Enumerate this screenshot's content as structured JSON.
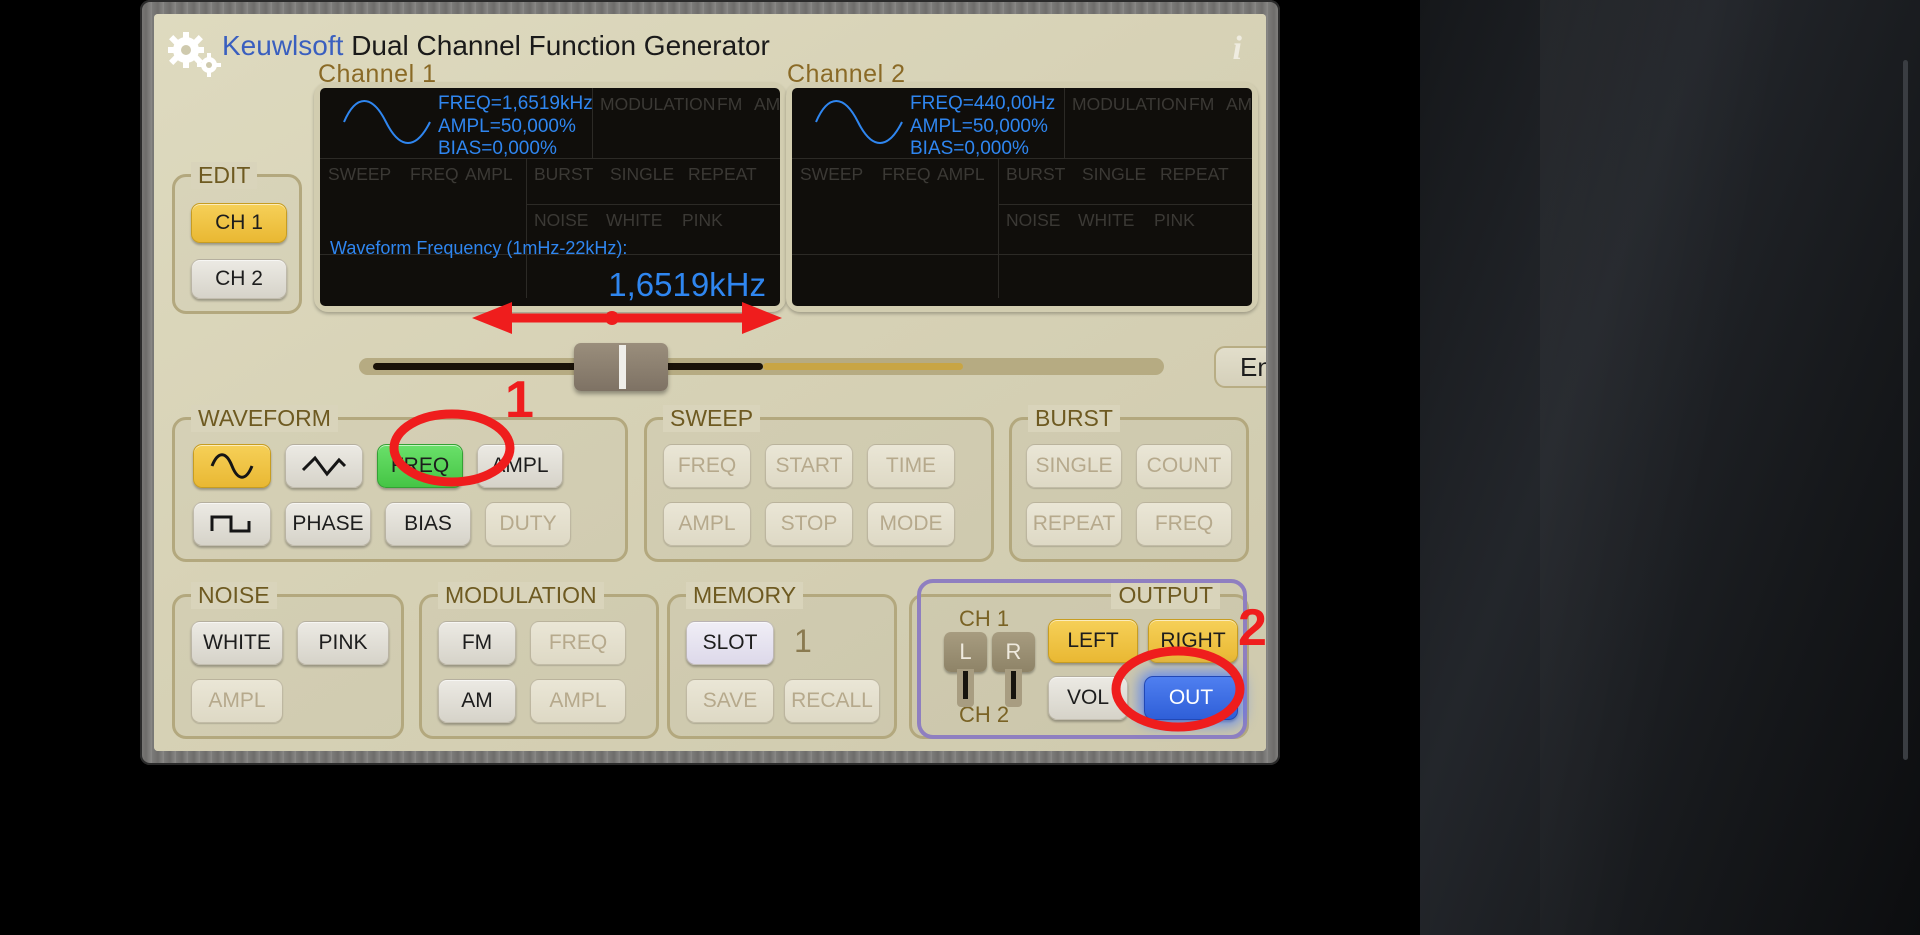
{
  "app": {
    "brand": "Keuwlsoft",
    "title": "Dual Channel Function Generator",
    "info_icon": "i",
    "gear_icon": "gears-icon"
  },
  "channels": {
    "ch1_label": "Channel 1",
    "ch2_label": "Channel 2"
  },
  "display_ch1": {
    "freq": "FREQ=1,6519kHz",
    "ampl": "AMPL=50,000%",
    "bias": "BIAS=0,000%",
    "modulation": "MODULATION",
    "fm": "FM",
    "am": "AM",
    "sweep": "SWEEP",
    "sweep_freq": "FREQ",
    "sweep_ampl": "AMPL",
    "burst": "BURST",
    "single": "SINGLE",
    "repeat": "REPEAT",
    "noise": "NOISE",
    "white": "WHITE",
    "pink": "PINK",
    "prompt": "Waveform Frequency (1mHz-22kHz):",
    "value": "1,6519kHz"
  },
  "display_ch2": {
    "freq": "FREQ=440,00Hz",
    "ampl": "AMPL=50,000%",
    "bias": "BIAS=0,000%",
    "modulation": "MODULATION",
    "fm": "FM",
    "am": "AM",
    "sweep": "SWEEP",
    "sweep_freq": "FREQ",
    "sweep_ampl": "AMPL",
    "burst": "BURST",
    "single": "SINGLE",
    "repeat": "REPEAT",
    "noise": "NOISE",
    "white": "WHITE",
    "pink": "PINK"
  },
  "edit": {
    "title": "EDIT",
    "ch1": "CH 1",
    "ch2": "CH 2"
  },
  "slider": {
    "enter_value": "Enter Value"
  },
  "waveform": {
    "title": "WAVEFORM",
    "sine_icon": "sine-wave-icon",
    "triangle_icon": "triangle-wave-icon",
    "square_icon": "square-wave-icon",
    "freq": "FREQ",
    "ampl": "AMPL",
    "phase": "PHASE",
    "bias": "BIAS",
    "duty": "DUTY"
  },
  "sweep": {
    "title": "SWEEP",
    "freq": "FREQ",
    "start": "START",
    "time": "TIME",
    "ampl": "AMPL",
    "stop": "STOP",
    "mode": "MODE"
  },
  "burst": {
    "title": "BURST",
    "single": "SINGLE",
    "count": "COUNT",
    "repeat": "REPEAT",
    "freq": "FREQ"
  },
  "noise": {
    "title": "NOISE",
    "white": "WHITE",
    "pink": "PINK",
    "ampl": "AMPL"
  },
  "modulation": {
    "title": "MODULATION",
    "fm": "FM",
    "freq": "FREQ",
    "am": "AM",
    "ampl": "AMPL"
  },
  "memory": {
    "title": "MEMORY",
    "slot": "SLOT",
    "slot_value": "1",
    "save": "SAVE",
    "recall": "RECALL"
  },
  "output": {
    "title": "OUTPUT",
    "ch1": "CH 1",
    "ch2": "CH 2",
    "jack_l": "L",
    "jack_r": "R",
    "left": "LEFT",
    "right": "RIGHT",
    "vol": "VOL",
    "out": "OUT"
  },
  "annotations": {
    "step1": "1",
    "step2": "2",
    "arrow_color": "#ef1d1d"
  },
  "colors": {
    "accent_blue": "#2f86f0",
    "panel": "#dedabf",
    "active_yellow": "#e9b833",
    "highlight_green": "#45c545",
    "output_on_blue": "#2f5fd8",
    "group_border": "#b3a87e",
    "output_frame": "#8f7fc0",
    "annotation_red": "#ef1d1d"
  }
}
